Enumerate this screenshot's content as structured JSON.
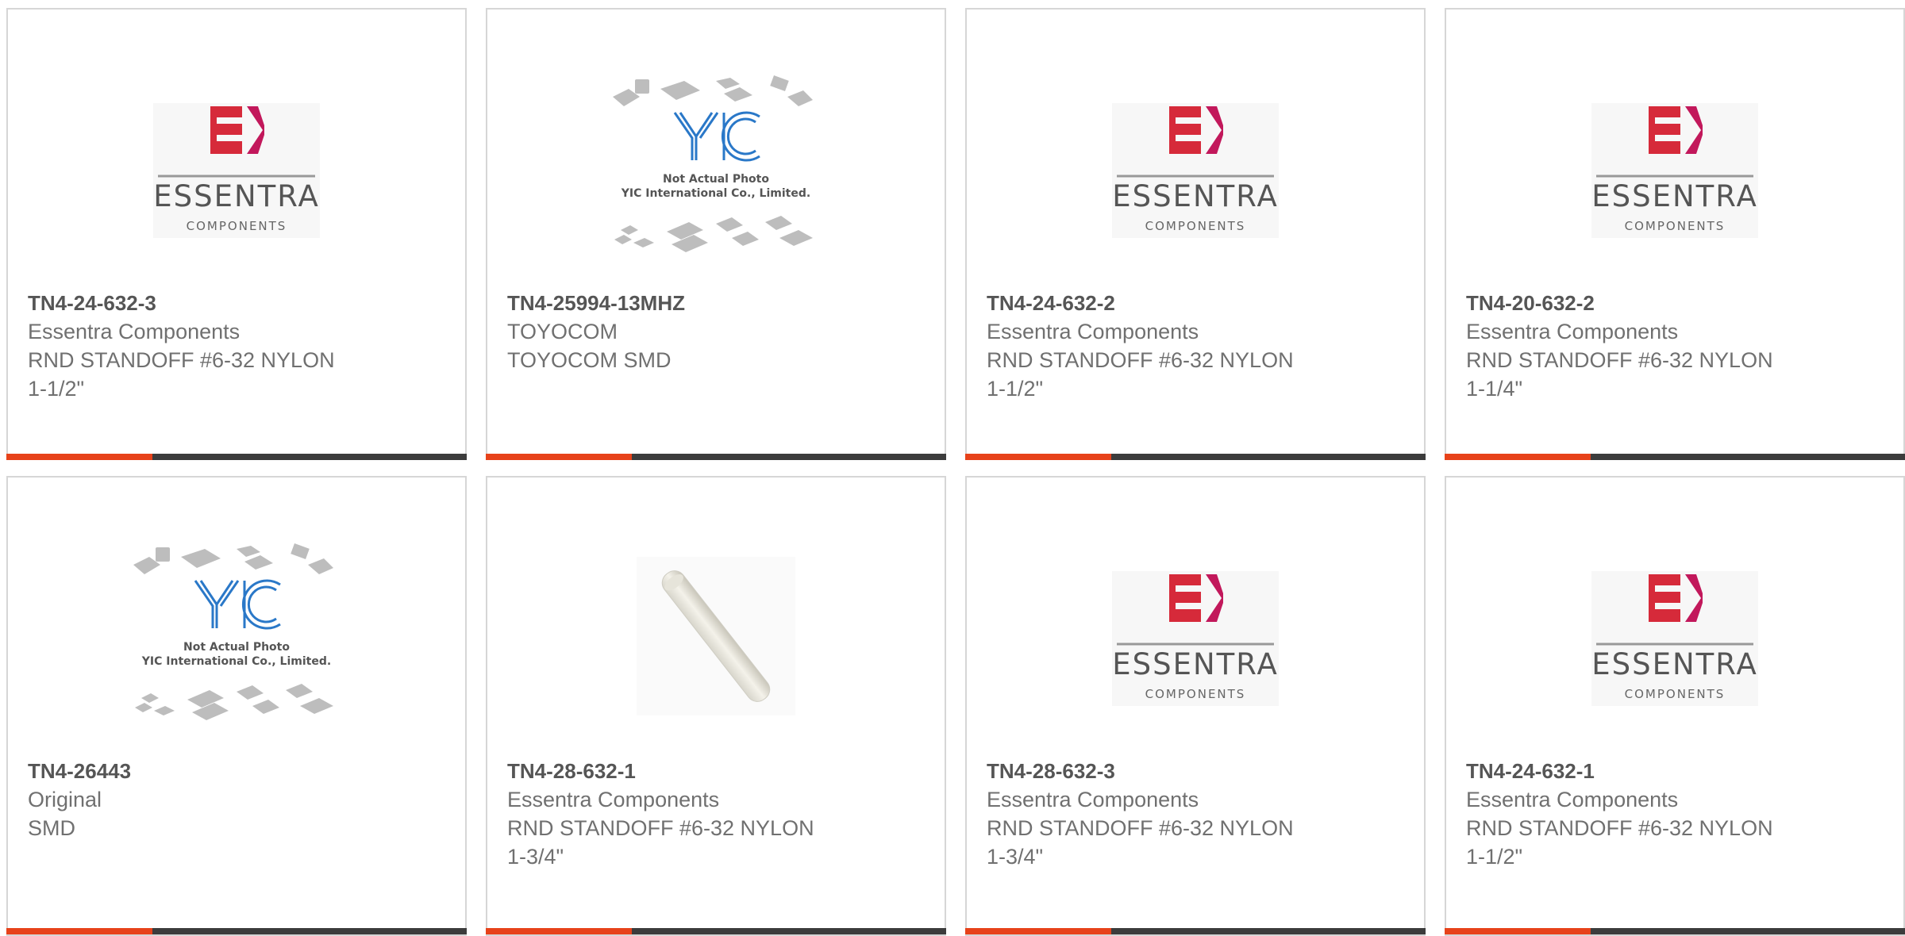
{
  "theme": {
    "accent": "#e7421a",
    "bar": "#3c3c3c",
    "border": "#d6d6d6",
    "text": "#707070"
  },
  "products": [
    {
      "part": "TN4-24-632-3",
      "maker": "Essentra Components",
      "desc1": "RND STANDOFF #6-32 NYLON",
      "desc2": "1-1/2\"",
      "image": "essentra-logo"
    },
    {
      "part": "TN4-25994-13MHZ",
      "maker": "TOYOCOM",
      "desc1": "TOYOCOM SMD",
      "desc2": "",
      "image": "yic-not-actual-photo"
    },
    {
      "part": "TN4-24-632-2",
      "maker": "Essentra Components",
      "desc1": "RND STANDOFF #6-32 NYLON",
      "desc2": "1-1/2\"",
      "image": "essentra-logo"
    },
    {
      "part": "TN4-20-632-2",
      "maker": "Essentra Components",
      "desc1": "RND STANDOFF #6-32 NYLON",
      "desc2": "1-1/4\"",
      "image": "essentra-logo"
    },
    {
      "part": "TN4-26443",
      "maker": "Original",
      "desc1": "SMD",
      "desc2": "",
      "image": "yic-not-actual-photo"
    },
    {
      "part": "TN4-28-632-1",
      "maker": "Essentra Components",
      "desc1": "RND STANDOFF #6-32 NYLON",
      "desc2": "1-3/4\"",
      "image": "standoff-photo"
    },
    {
      "part": "TN4-28-632-3",
      "maker": "Essentra Components",
      "desc1": "RND STANDOFF #6-32 NYLON",
      "desc2": "1-3/4\"",
      "image": "essentra-logo"
    },
    {
      "part": "TN4-24-632-1",
      "maker": "Essentra Components",
      "desc1": "RND STANDOFF #6-32 NYLON",
      "desc2": "1-1/2\"",
      "image": "essentra-logo"
    }
  ],
  "logo_text": {
    "essentra": "ESSENTRA",
    "components": "COMPONENTS",
    "yic_mark": "YIC",
    "yic_note1": "Not Actual Photo",
    "yic_note2": "YIC International Co., Limited."
  }
}
